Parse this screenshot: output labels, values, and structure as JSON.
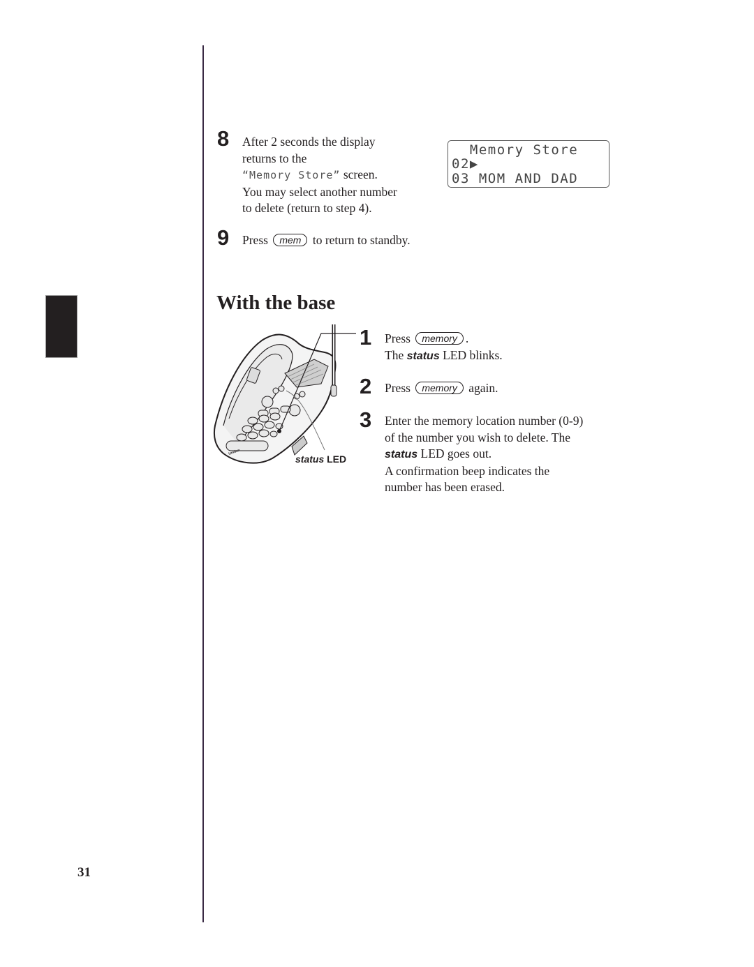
{
  "page": {
    "page_number": "31",
    "section_tab": "thumb-index-tab"
  },
  "step8": {
    "number": "8",
    "line1": "After 2 seconds the display",
    "line2": "returns to the",
    "lcd_ref": "“Memory Store”",
    "line3_suffix": " screen.",
    "line4": "You may select another number",
    "line5": "to delete (return to step 4)."
  },
  "lcd_display": {
    "line1": "  Memory Store",
    "line2": "02▶",
    "line3": "03 MOM AND DAD"
  },
  "step9": {
    "number": "9",
    "prefix": "Press",
    "key": "mem",
    "suffix": "to return to standby."
  },
  "section": {
    "title": "With the base"
  },
  "figure": {
    "label_italic": "status",
    "label_rest": " LED",
    "brand": "Uniden"
  },
  "base_steps": [
    {
      "number": "1",
      "prefix": "Press",
      "key": "memory",
      "suffix": ".",
      "line2_prefix": "The ",
      "line2_bold": "status",
      "line2_suffix": " LED blinks."
    },
    {
      "number": "2",
      "prefix": "Press",
      "key": "memory",
      "suffix": "again."
    },
    {
      "number": "3",
      "line1": "Enter the memory location number (0-9)",
      "line2": "of the number you wish to delete. The",
      "line3_bold": "status",
      "line3_suffix": " LED goes out.",
      "line4": "A confirmation beep indicates the",
      "line5": "number has been erased."
    }
  ]
}
